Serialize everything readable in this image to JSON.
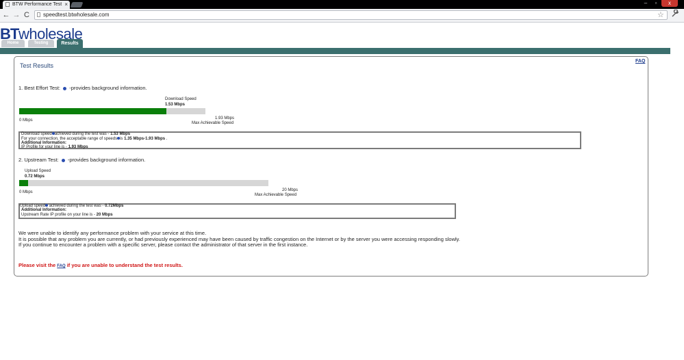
{
  "browser": {
    "tab_title": "BTW Performance Test",
    "tab_close": "×",
    "url": "speedtest.btwholesale.com",
    "back": "←",
    "forward": "→",
    "reload": "C",
    "star": "☆",
    "wrench": "🔧",
    "win_min": "–",
    "win_max": "▫",
    "win_close": "x"
  },
  "site": {
    "logo_bt": "BT",
    "logo_wholesale": "wholesale",
    "tabs": [
      "Home",
      "Testing",
      "Results"
    ],
    "faq": "FAQ",
    "page_title": "Test Results"
  },
  "download": {
    "title_pre": "1. Best Effort Test:",
    "title_post": "-provides background information.",
    "speed_label": "Download Speed",
    "speed_value": "1.53 Mbps",
    "fill_fraction": 0.79,
    "min_label": "0 Mbps",
    "max_value": "1.93 Mbps",
    "max_label": "Max Achievable Speed",
    "info": {
      "line1_pre": "Download speed",
      "line1_mid": "achieved during the test was - ",
      "line1_val": "1.53 Mbps",
      "line2_pre": "For your connection, the acceptable range of speeds",
      "line2_mid": "is ",
      "line2_val": "1.35 Mbps-1.93 Mbps",
      "line2_post": " .",
      "line3": "Additional Information:",
      "line4_pre": "IP Profile for your line is - ",
      "line4_val": "1.93 Mbps"
    }
  },
  "upload": {
    "title_pre": "2. Upstream Test:",
    "title_post": "-provides background information.",
    "speed_label": "Upload Speed",
    "speed_value": "0.72 Mbps",
    "fill_fraction": 0.036,
    "min_label": "0 Mbps",
    "max_value": "20 Mbps",
    "max_label": "Max Achievable Speed",
    "info": {
      "line1_pre": "Upload speed",
      "line1_mid": " achieved during the test was - ",
      "line1_val": "0.72Mbps",
      "line2": "Additional Information:",
      "line3_pre": "Upstream Rate IP profile on your line is - ",
      "line3_val": "20 Mbps"
    }
  },
  "messages": {
    "p1": "We were unable to identify any performance problem with your service at this time.",
    "p2": "It is possible that any problem you are currently, or had previously experienced may have been caused by traffic congestion on the Internet or by the server you were accessing responding slowly.",
    "p3": "If you continue to encounter a problem with a specific server, please contact the administrator of that server in the first instance.",
    "visit_pre": "Please visit the ",
    "visit_link": "FAQ",
    "visit_post": " if you are unable to understand the test results."
  },
  "colors": {
    "accent": "#3b6f6e",
    "bar_fill": "#0a7f0a",
    "bar_bg": "#d6d6d6",
    "logo": "#1b3a8c",
    "alert": "#d01616"
  }
}
